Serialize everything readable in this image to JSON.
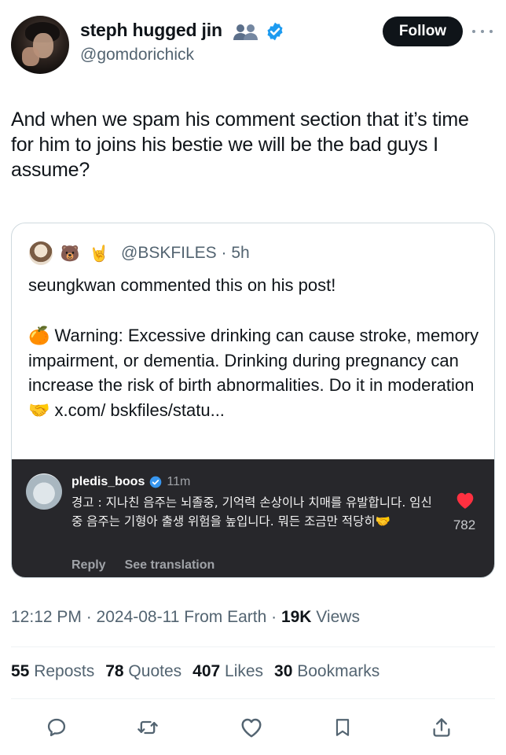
{
  "author": {
    "display_name": "steph hugged jin",
    "handle": "@gomdorichick",
    "name_emoji": "people-silhouette-emoji",
    "verified_color": "#1d9bf0"
  },
  "follow_label": "Follow",
  "tweet_text": "And when we spam his comment section that it’s time for him to joins his bestie we will be the bad guys I assume?",
  "quote": {
    "handle_time": "@BSKFILES · 5h",
    "avatar_emojis": [
      "person-avatar",
      "🐻",
      "🤘"
    ],
    "line1": "seungkwan commented this on his post!",
    "warning_emoji": "🍊",
    "warning_text": " Warning: Excessive drinking can cause stroke, memory impairment, or dementia. Drinking during pregnancy can increase the risk of birth abnormalities. Do it in moderation ",
    "handshake_emoji": "🤝",
    "link_text": " x.com/ bskfiles/statu..."
  },
  "comment": {
    "username": "pledis_boos",
    "time": "11m",
    "text": "경고 : 지나친 음주는 뇌졸중, 기억력 손상이나 치매를 유발합니다. 임신 중 음주는 기형아 출생 위험을 높입니다. 뭐든 조금만 적당히🤝",
    "like_count": "782",
    "reply_label": "Reply",
    "translate_label": "See translation",
    "heart_color": "#ff3040"
  },
  "meta": {
    "time_date": "12:12 PM · 2024-08-11 From Earth · ",
    "views_count": "19K",
    "views_label": " Views"
  },
  "stats": {
    "reposts_count": "55",
    "reposts_label": " Reposts",
    "quotes_count": "78",
    "quotes_label": " Quotes",
    "likes_count": "407",
    "likes_label": " Likes",
    "bookmarks_count": "30",
    "bookmarks_label": " Bookmarks"
  },
  "action_icons": [
    "reply-icon",
    "repost-icon",
    "like-icon",
    "bookmark-icon",
    "share-icon"
  ],
  "colors": {
    "text": "#0f1419",
    "secondary": "#536471",
    "accent": "#1d9bf0",
    "embed_bg": "#27272b"
  }
}
